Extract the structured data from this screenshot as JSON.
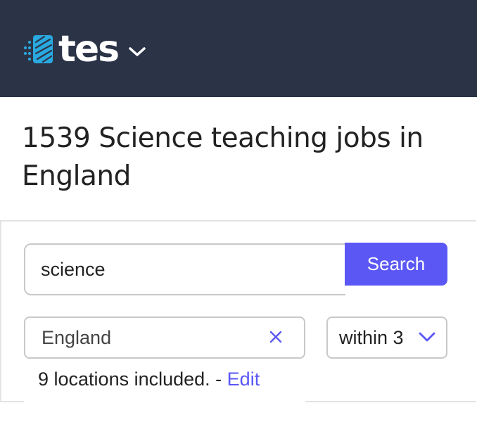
{
  "header": {
    "logo_text": "tes",
    "logo_icon": "tes-dotted-mark-icon",
    "menu_icon": "chevron-down-icon",
    "background": "#2b3447",
    "logo_accent": "#29a9e0"
  },
  "page": {
    "count": "1539",
    "title": "Science teaching jobs in England"
  },
  "search": {
    "query_value": "science",
    "button_label": "Search",
    "button_color": "#5b57f5"
  },
  "location": {
    "value": "England",
    "clear_icon": "close-icon",
    "radius_value": "within 3",
    "radius_icon": "chevron-down-icon",
    "note": "9 locations included.",
    "separator": " - ",
    "edit_label": "Edit"
  }
}
